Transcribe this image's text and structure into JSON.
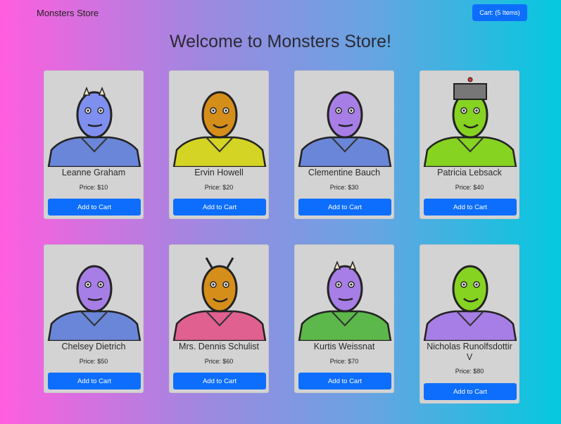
{
  "navbar": {
    "brand": "Monsters Store",
    "cart_label": "Cart: (5 Items)"
  },
  "page_title": "Welcome to Monsters Store!",
  "products": [
    {
      "name": "Leanne Graham",
      "price": "Price: $10",
      "button": "Add to Cart",
      "skin": "#7f8ff0",
      "body": "#6a86d8"
    },
    {
      "name": "Ervin Howell",
      "price": "Price: $20",
      "button": "Add to Cart",
      "skin": "#d68e1a",
      "body": "#d4d424"
    },
    {
      "name": "Clementine Bauch",
      "price": "Price: $30",
      "button": "Add to Cart",
      "skin": "#a77ee6",
      "body": "#6a86d8"
    },
    {
      "name": "Patricia Lebsack",
      "price": "Price: $40",
      "button": "Add to Cart",
      "skin": "#86d321",
      "body": "#86d321"
    },
    {
      "name": "Chelsey Dietrich",
      "price": "Price: $50",
      "button": "Add to Cart",
      "skin": "#a77ee6",
      "body": "#6a86d8"
    },
    {
      "name": "Mrs. Dennis Schulist",
      "price": "Price: $60",
      "button": "Add to Cart",
      "skin": "#d68e1a",
      "body": "#e06090"
    },
    {
      "name": "Kurtis Weissnat",
      "price": "Price: $70",
      "button": "Add to Cart",
      "skin": "#a77ee6",
      "body": "#5cb84a"
    },
    {
      "name": "Nicholas Runolfsdottir V",
      "price": "Price: $80",
      "button": "Add to Cart",
      "skin": "#86d321",
      "body": "#a77ee6"
    }
  ]
}
